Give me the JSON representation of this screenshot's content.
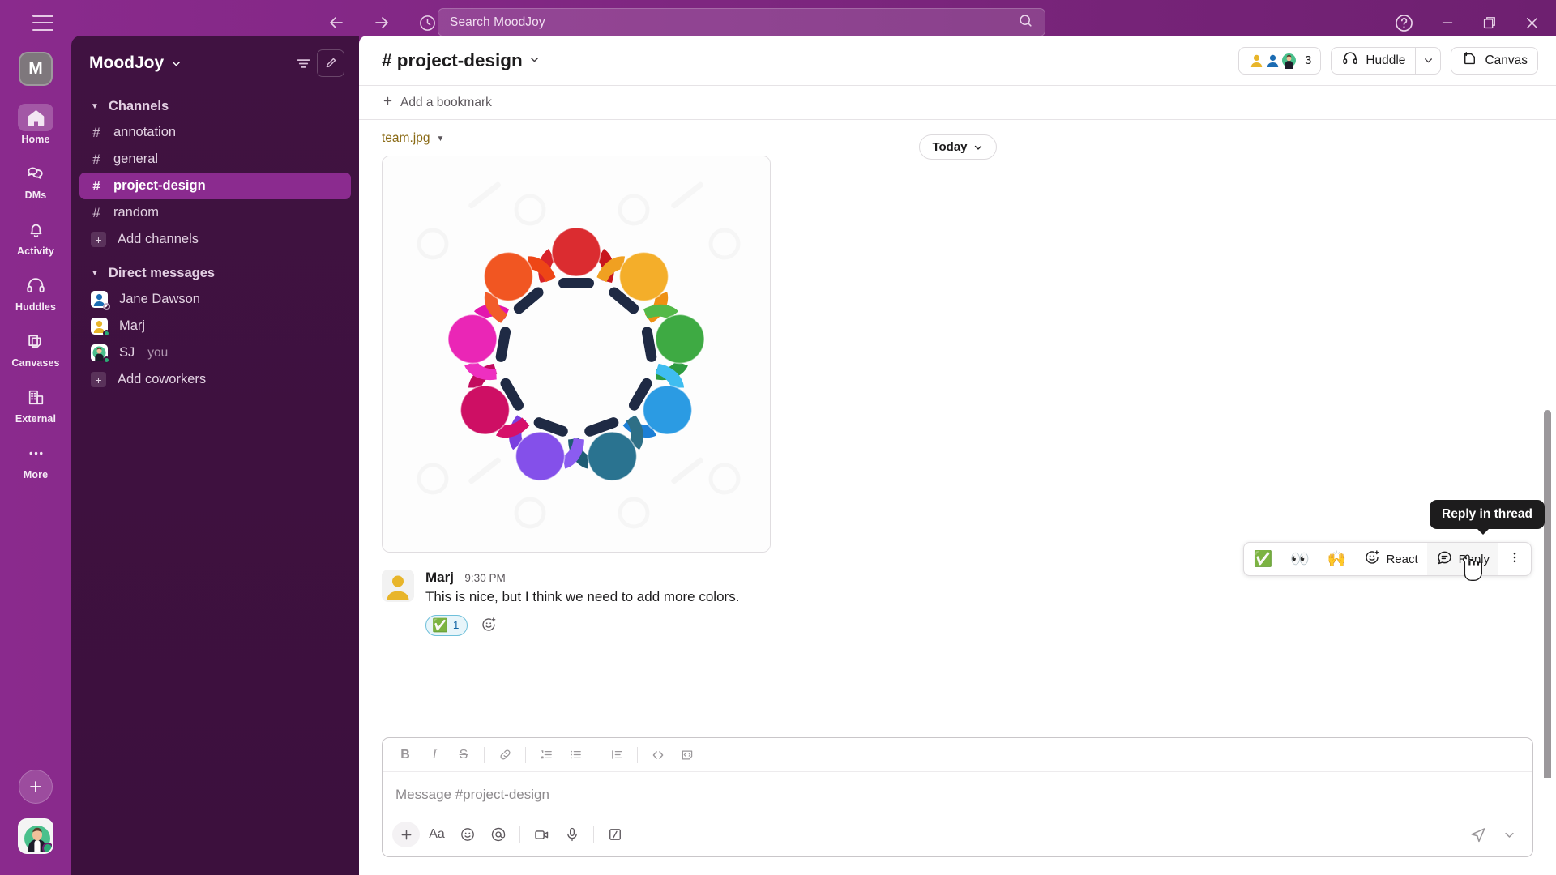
{
  "titlebar": {
    "menu_icon": "hamburger-icon",
    "back_icon": "arrow-left-icon",
    "forward_icon": "arrow-right-icon",
    "history_icon": "clock-icon",
    "search_placeholder": "Search MoodJoy",
    "search_icon": "search-icon",
    "help_icon": "help-circle-icon",
    "minimize_icon": "minimize-icon",
    "maximize_icon": "restore-icon",
    "close_icon": "close-icon"
  },
  "rail": {
    "workspace_initial": "M",
    "items": [
      {
        "label": "Home",
        "icon": "home-icon",
        "active": true
      },
      {
        "label": "DMs",
        "icon": "dms-icon",
        "active": false
      },
      {
        "label": "Activity",
        "icon": "bell-icon",
        "active": false
      },
      {
        "label": "Huddles",
        "icon": "headphones-icon",
        "active": false
      },
      {
        "label": "Canvases",
        "icon": "canvas-icon",
        "active": false
      },
      {
        "label": "External",
        "icon": "building-icon",
        "active": false
      },
      {
        "label": "More",
        "icon": "ellipsis-icon",
        "active": false
      }
    ],
    "new_label": "+",
    "avatar_name": "user-avatar"
  },
  "sidebar": {
    "workspace_name": "MoodJoy",
    "filter_icon": "filter-icon",
    "compose_icon": "compose-icon",
    "channels_section": {
      "title": "Channels",
      "items": [
        {
          "label": "annotation",
          "prefix": "#",
          "active": false
        },
        {
          "label": "general",
          "prefix": "#",
          "active": false
        },
        {
          "label": "project-design",
          "prefix": "#",
          "active": true
        },
        {
          "label": "random",
          "prefix": "#",
          "active": false
        }
      ],
      "add_label": "Add channels"
    },
    "dm_section": {
      "title": "Direct messages",
      "items": [
        {
          "label": "Jane Dawson",
          "suffix": "",
          "presence": "away",
          "avatar": "#1B6CB3"
        },
        {
          "label": "Marj",
          "suffix": "",
          "presence": "online",
          "avatar": "#E8B52A"
        },
        {
          "label": "SJ",
          "suffix": "you",
          "presence": "online",
          "avatar": "#45BE8C"
        }
      ],
      "add_label": "Add coworkers"
    }
  },
  "channel": {
    "name": "# project-design",
    "caret_icon": "chevron-down-icon",
    "members_count": "3",
    "huddle_label": "Huddle",
    "huddle_icon": "headphones-icon",
    "canvas_label": "Canvas",
    "canvas_icon": "canvas-plus-icon",
    "bookmark_label": "Add a bookmark"
  },
  "messages": {
    "today_label": "Today",
    "file": {
      "filename": "team.jpg",
      "alt": "Circle of nine colorful stylized people holding hands"
    },
    "message": {
      "author": "Marj",
      "time": "9:30 PM",
      "text": "This is nice, but I think we need to add more colors.",
      "reaction_emoji": "✅",
      "reaction_count": "1",
      "add_reaction_icon": "add-reaction-icon"
    },
    "hover_toolbar": {
      "quick_emojis": [
        "✅",
        "👀",
        "🙌"
      ],
      "react_label": "React",
      "react_icon": "emoji-plus-icon",
      "reply_label": "Reply",
      "reply_icon": "thread-icon",
      "more_icon": "more-vertical-icon"
    },
    "tooltip": "Reply in thread"
  },
  "composer": {
    "placeholder": "Message #project-design",
    "format_buttons": [
      {
        "label": "B",
        "name": "bold-button"
      },
      {
        "label": "I",
        "name": "italic-button"
      },
      {
        "label": "S",
        "name": "strikethrough-button"
      },
      {
        "label": "link",
        "name": "link-button"
      },
      {
        "label": "ol",
        "name": "ordered-list-button"
      },
      {
        "label": "ul",
        "name": "bulleted-list-button"
      },
      {
        "label": "quote",
        "name": "blockquote-button"
      },
      {
        "label": "code",
        "name": "code-button"
      },
      {
        "label": "codeblock",
        "name": "code-block-button"
      }
    ],
    "actions": [
      {
        "name": "attach-plus-button",
        "label": "+"
      },
      {
        "name": "formatting-button",
        "label": "Aa"
      },
      {
        "name": "emoji-button",
        "label": "emoji"
      },
      {
        "name": "mention-button",
        "label": "@"
      },
      {
        "name": "video-clip-button",
        "label": "video"
      },
      {
        "name": "audio-clip-button",
        "label": "mic"
      },
      {
        "name": "slash-command-button",
        "label": "slash"
      }
    ],
    "send_icon": "send-icon"
  },
  "colors": {
    "brand_purple": "#6E2070",
    "sidebar_purple": "#3F1140",
    "active_channel": "#8B2B8F",
    "accent_link": "#1264A3",
    "online_green": "#2BAC76"
  }
}
